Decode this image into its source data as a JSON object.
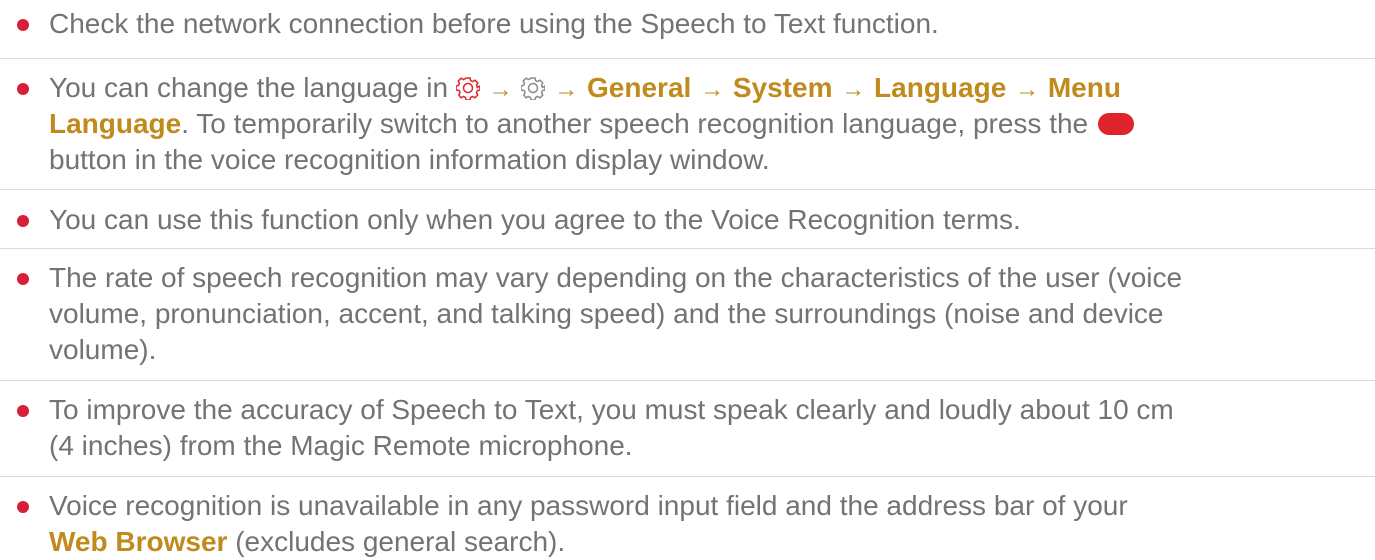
{
  "notes": [
    {
      "lines": [
        "Check the network connection before using the Speech to Text function."
      ]
    },
    {
      "line1_prefix": "You can change the language in",
      "path": [
        "General",
        "System",
        "Language",
        "Menu"
      ],
      "line2_menu": "Language",
      "line2_text": ". To temporarily switch to another speech recognition language, press the",
      "line3_text": "button in the voice recognition information display window."
    },
    {
      "lines": [
        "You can use this function only when you agree to the Voice Recognition terms."
      ]
    },
    {
      "lines": [
        "The rate of speech recognition may vary depending on the characteristics of the user (voice",
        "volume, pronunciation, accent, and talking speed) and the surroundings (noise and device",
        "volume)."
      ]
    },
    {
      "lines": [
        "To improve the accuracy of Speech to Text, you must speak clearly and loudly about 10 cm",
        "(4 inches) from the Magic Remote microphone."
      ]
    },
    {
      "line1": "Voice recognition is unavailable in any password input field and the address bar of your",
      "line2_menu": "Web Browser",
      "line2_text": " (excludes general search)."
    }
  ],
  "icons": {
    "settings_gear": "settings-gear-icon",
    "all_settings_gear": "all-settings-gear-icon",
    "arrow": "arrow-right-icon",
    "red_button": "red-button-icon"
  },
  "colors": {
    "text": "#737373",
    "menu_highlight": "#c08a1c",
    "bullet": "#d81e3b",
    "red_button": "#e0242d"
  }
}
